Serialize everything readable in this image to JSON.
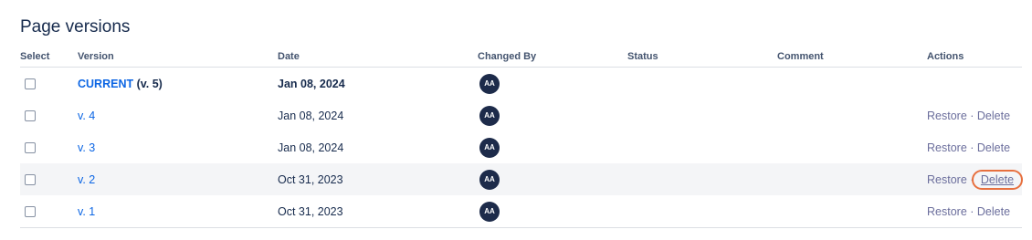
{
  "page": {
    "title": "Page versions"
  },
  "columns": {
    "select": "Select",
    "version": "Version",
    "date": "Date",
    "changed_by": "Changed By",
    "status": "Status",
    "comment": "Comment",
    "actions": "Actions"
  },
  "rows": [
    {
      "version": "CURRENT",
      "version_suffix": " (v. 5)",
      "date": "Jan 08, 2024",
      "avatar": "AA",
      "status": "",
      "comment": ""
    },
    {
      "version": "v. 4",
      "date": "Jan 08, 2024",
      "avatar": "AA",
      "status": "",
      "comment": "",
      "restore": "Restore",
      "sep": " · ",
      "delete": "Delete"
    },
    {
      "version": "v. 3",
      "date": "Jan 08, 2024",
      "avatar": "AA",
      "status": "",
      "comment": "",
      "restore": "Restore",
      "sep": " · ",
      "delete": "Delete"
    },
    {
      "version": "v. 2",
      "date": "Oct 31, 2023",
      "avatar": "AA",
      "status": "",
      "comment": "",
      "restore": "Restore",
      "sep": " · ",
      "delete": "Delete",
      "highlighted": true,
      "delete_circled": true
    },
    {
      "version": "v. 1",
      "date": "Oct 31, 2023",
      "avatar": "AA",
      "status": "",
      "comment": "",
      "restore": "Restore",
      "sep": " · ",
      "delete": "Delete"
    }
  ],
  "colors": {
    "link": "#0c66e4",
    "action": "#6b6e9c",
    "avatar_bg": "#1d2b4a",
    "annotation_circle": "#e7703f",
    "row_highlight": "#f4f5f7"
  }
}
